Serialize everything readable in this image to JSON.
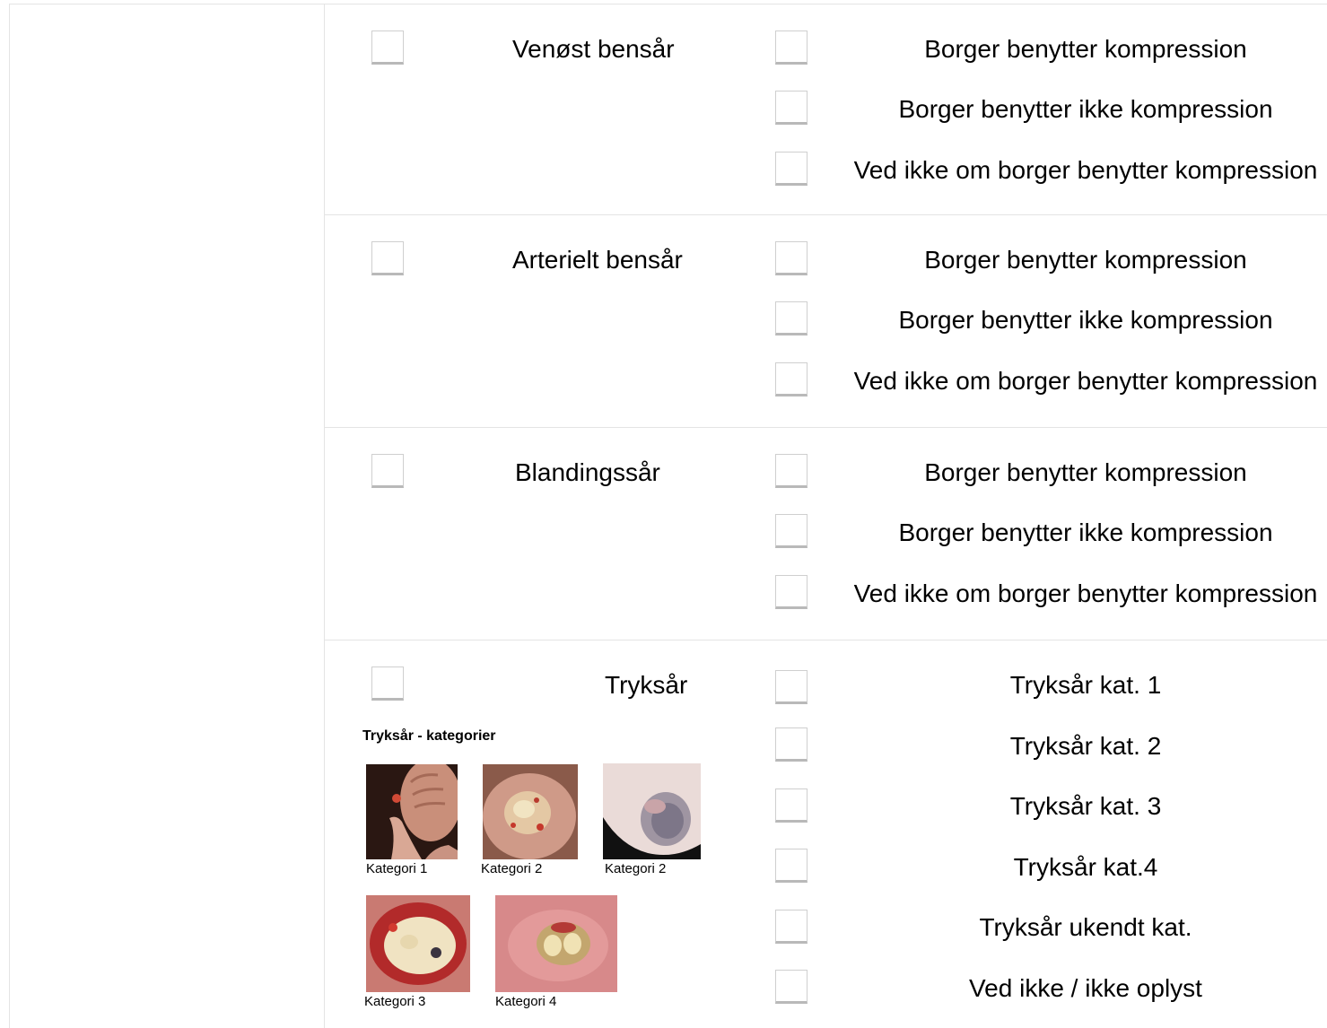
{
  "sections": [
    {
      "label": "Venøst bensår",
      "options": [
        "Borger benytter kompression",
        "Borger benytter ikke kompression",
        "Ved ikke om borger benytter kompression"
      ]
    },
    {
      "label": "Arterielt bensår",
      "options": [
        "Borger benytter kompression",
        "Borger benytter ikke kompression",
        "Ved ikke om borger benytter kompression"
      ]
    },
    {
      "label": "Blandingssår",
      "options": [
        "Borger benytter kompression",
        "Borger benytter ikke kompression",
        "Ved ikke om borger benytter kompression"
      ]
    },
    {
      "label": "Tryksår",
      "options": [
        "Tryksår kat. 1",
        "Tryksår kat. 2",
        "Tryksår kat. 3",
        "Tryksår kat.4",
        "Tryksår ukendt kat.",
        "Ved ikke / ikke oplyst"
      ]
    }
  ],
  "categories_figure": {
    "title": "Tryksår - kategorier",
    "captions": [
      "Kategori 1",
      "Kategori 2",
      "Kategori 2",
      "Kategori 3",
      "Kategori 4"
    ]
  }
}
